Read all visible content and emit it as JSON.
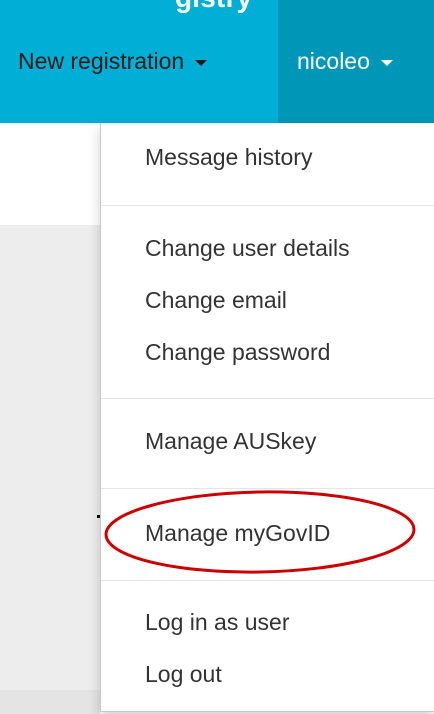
{
  "navbar": {
    "title_fragment": "gistry",
    "new_registration": "New registration",
    "username": "nicoleo"
  },
  "dropdown": {
    "items": [
      {
        "label": "Message history"
      },
      {
        "label": "Change user details"
      },
      {
        "label": "Change email"
      },
      {
        "label": "Change password"
      },
      {
        "label": "Manage AUSkey"
      },
      {
        "label": "Manage myGovID"
      },
      {
        "label": "Log in as user"
      },
      {
        "label": "Log out"
      }
    ]
  },
  "colors": {
    "navbar": "#00aed6",
    "user_menu": "#0096b8",
    "annotation": "#cc0000"
  },
  "icons": [
    "caret-down-icon"
  ],
  "annotation": {
    "highlighted_item": "Manage myGovID"
  }
}
